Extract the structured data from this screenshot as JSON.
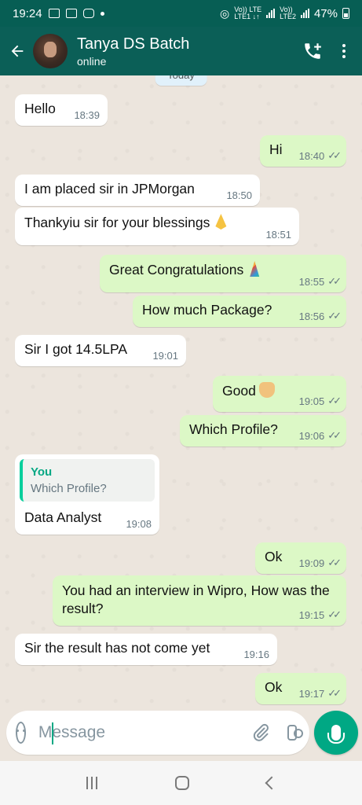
{
  "status_bar": {
    "time": "19:24",
    "battery": "47%",
    "lte1_line1": "Vo)) LTE",
    "lte1_line2": "LTE1 ↓↑",
    "lte2_line1": "Vo))",
    "lte2_line2": "LTE2"
  },
  "header": {
    "title": "Tanya DS Batch",
    "status": "online"
  },
  "date_chip": "Today",
  "messages": [
    {
      "dir": "in",
      "text": "Hello",
      "time": "18:39"
    },
    {
      "dir": "out",
      "text": "Hi",
      "time": "18:40"
    },
    {
      "dir": "in",
      "text": "I am placed sir in JPMorgan",
      "time": "18:50"
    },
    {
      "dir": "in",
      "text": "Thankyiu sir for your blessings",
      "time": "18:51"
    },
    {
      "dir": "out",
      "text": "Great Congratulations",
      "time": "18:55"
    },
    {
      "dir": "out",
      "text": "How much Package?",
      "time": "18:56"
    },
    {
      "dir": "in",
      "text": "Sir I got 14.5LPA",
      "time": "19:01"
    },
    {
      "dir": "out",
      "text": "Good",
      "time": "19:05"
    },
    {
      "dir": "out",
      "text": "Which Profile?",
      "time": "19:06"
    },
    {
      "dir": "in",
      "text": "Data Analyst",
      "time": "19:08",
      "quote_author": "You",
      "quote_text": "Which Profile?"
    },
    {
      "dir": "out",
      "text": "Ok",
      "time": "19:09"
    },
    {
      "dir": "out",
      "text": "You had an interview in Wipro, How was the result?",
      "time": "19:15"
    },
    {
      "dir": "in",
      "text": "Sir the result has not come yet",
      "time": "19:16"
    },
    {
      "dir": "out",
      "text": "Ok",
      "time": "19:17"
    }
  ],
  "composer": {
    "placeholder": "Message"
  },
  "icons": {
    "back": "arrow-left-icon",
    "call": "add-call-icon",
    "menu": "more-vertical-icon",
    "emoji": "smiley-icon",
    "attach": "paperclip-icon",
    "camera": "camera-icon",
    "mic": "microphone-icon"
  },
  "colors": {
    "header": "#075e54",
    "outgoing_bubble": "#dcf8c6",
    "incoming_bubble": "#ffffff",
    "accent": "#00a884",
    "chat_bg": "#ece5dd"
  }
}
